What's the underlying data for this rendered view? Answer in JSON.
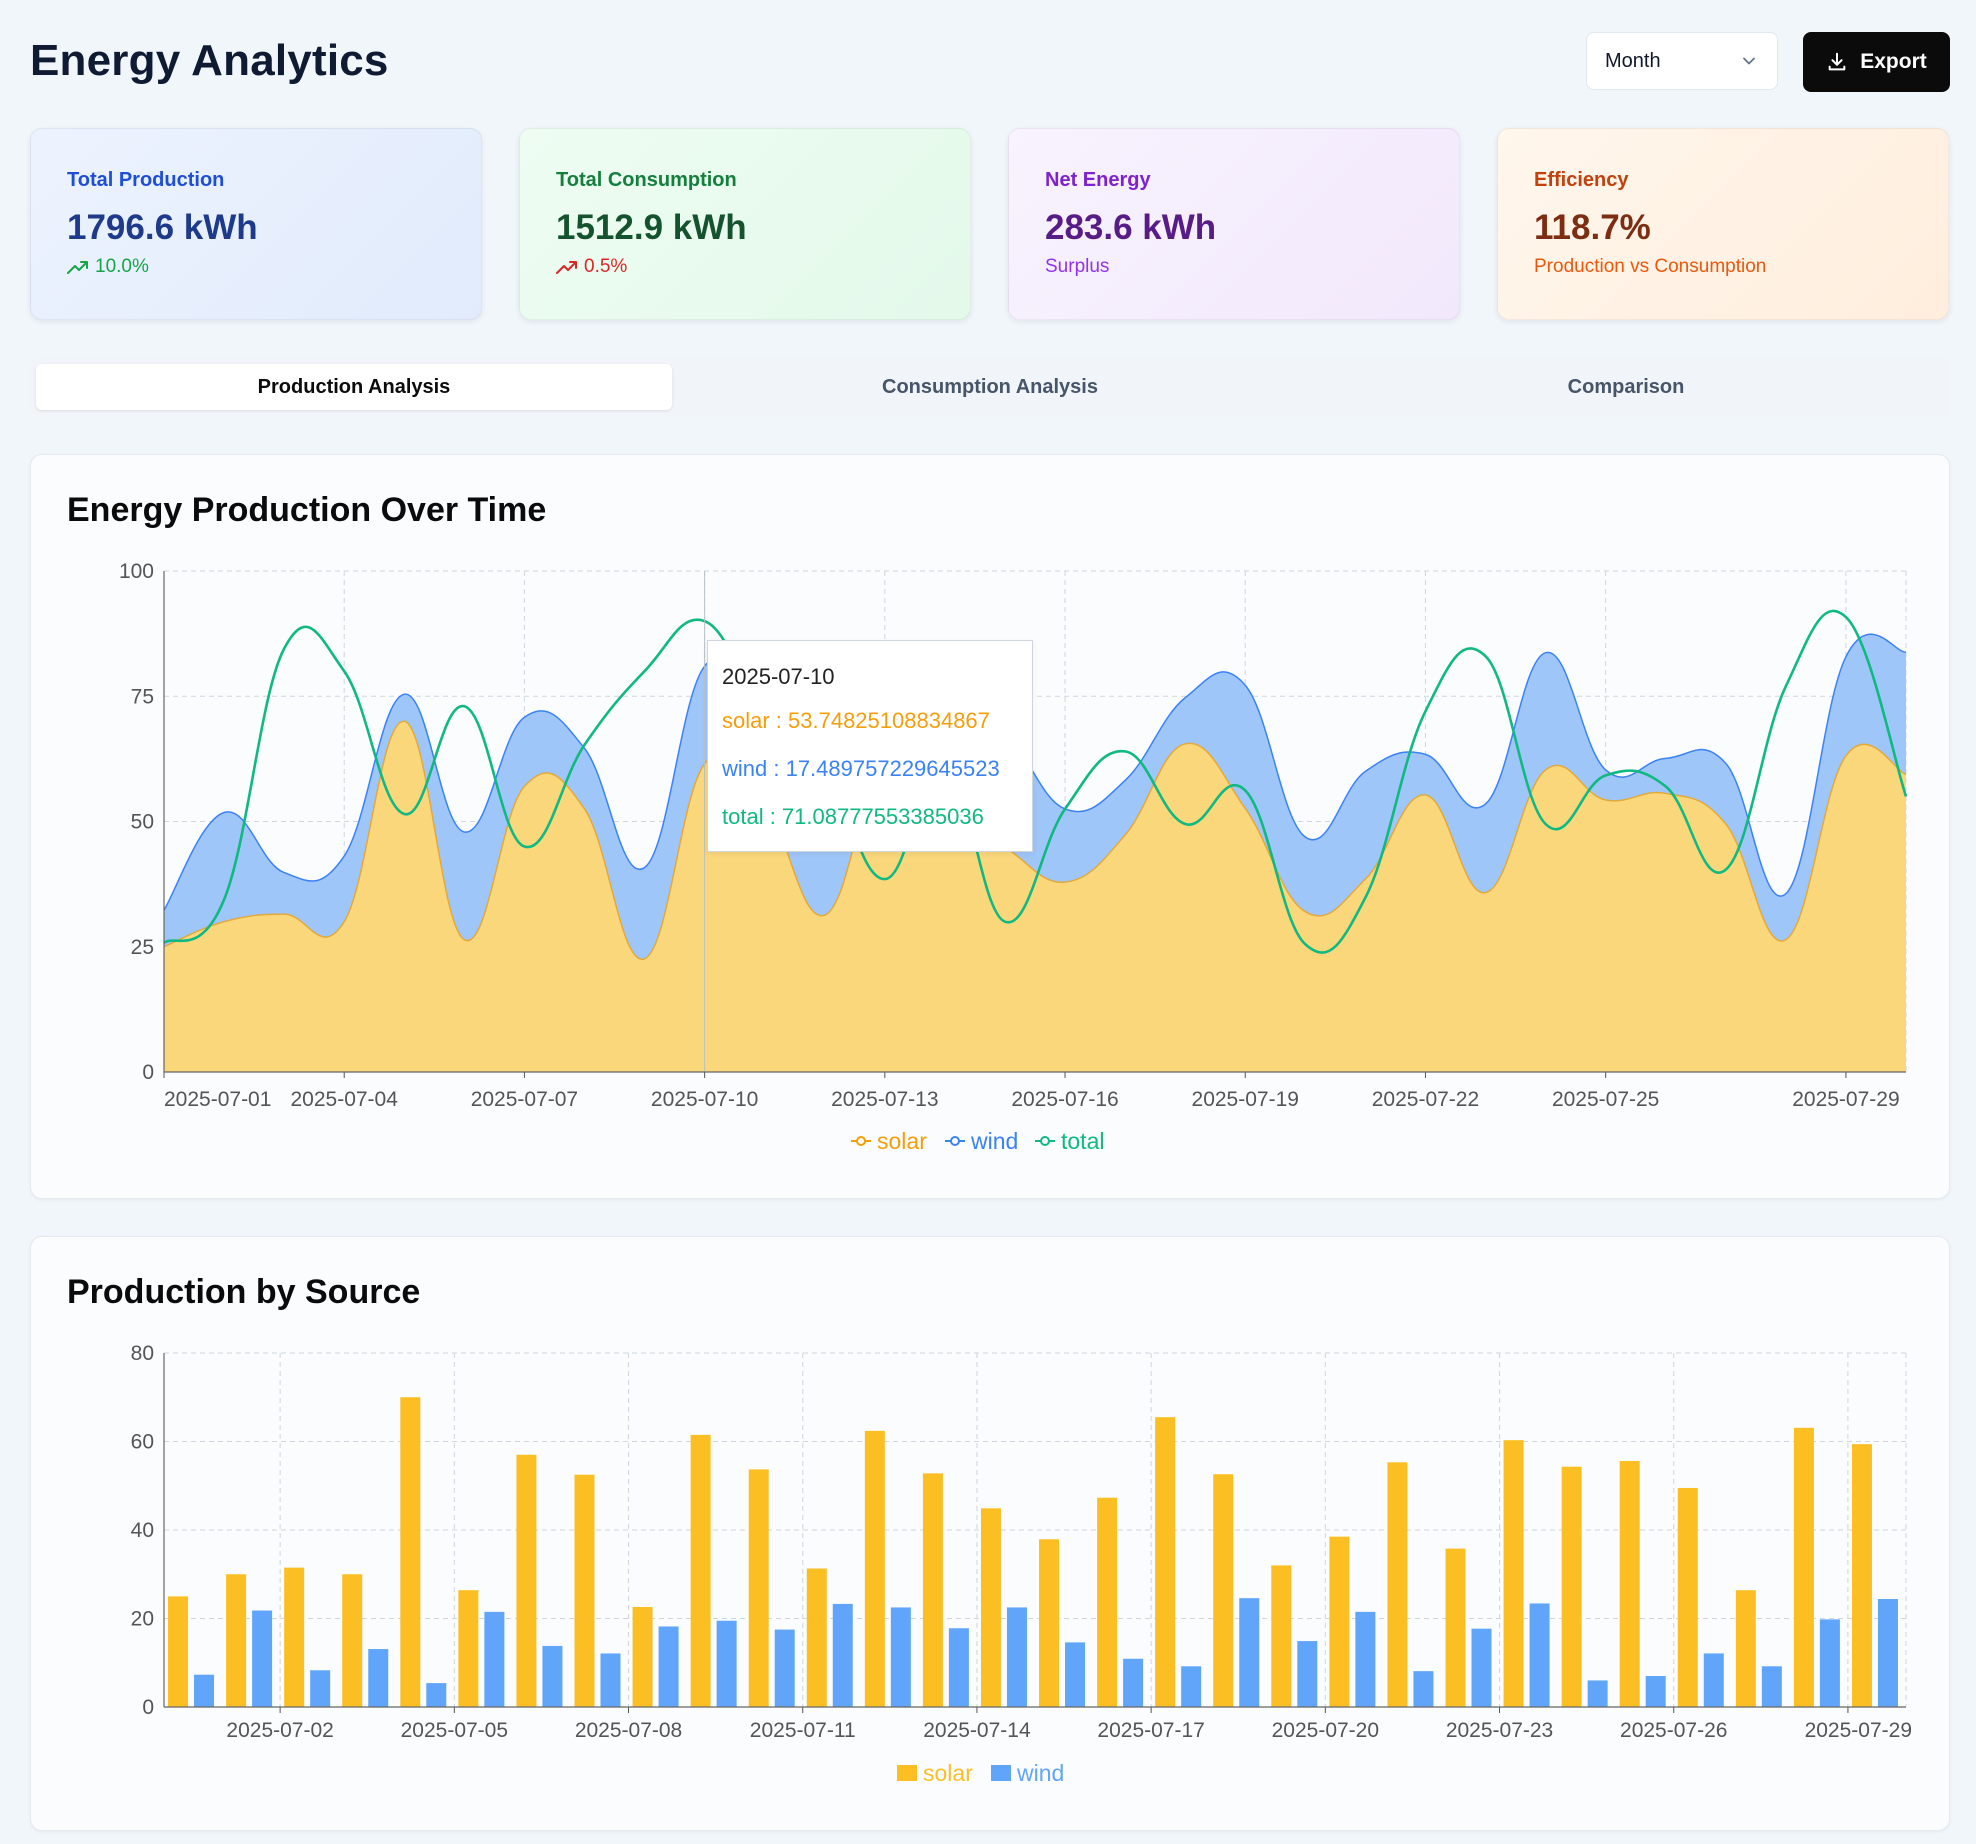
{
  "header": {
    "title": "Energy Analytics",
    "period_select": {
      "value": "Month"
    },
    "export_label": "Export"
  },
  "kpis": [
    {
      "label": "Total Production",
      "value": "1796.6 kWh",
      "sub": "10.0%",
      "trend": "up"
    },
    {
      "label": "Total Consumption",
      "value": "1512.9 kWh",
      "sub": "0.5%",
      "trend": "up"
    },
    {
      "label": "Net Energy",
      "value": "283.6 kWh",
      "sub": "Surplus"
    },
    {
      "label": "Efficiency",
      "value": "118.7%",
      "sub": "Production vs Consumption"
    }
  ],
  "tabs": [
    {
      "label": "Production Analysis",
      "active": true
    },
    {
      "label": "Consumption Analysis",
      "active": false
    },
    {
      "label": "Comparison",
      "active": false
    }
  ],
  "colors": {
    "solar": "#f59e0b",
    "solar_fill": "#fbd77c",
    "solar_bar": "#fbbf24",
    "wind": "#3b82f6",
    "wind_fill": "#9fc6f8",
    "wind_bar": "#60a5fa",
    "total": "#10b981"
  },
  "tooltip": {
    "date": "2025-07-10",
    "solar": "solar : 53.74825108834867",
    "wind": "wind : 17.489757229645523",
    "total": "total : 71.08777553385036"
  },
  "chart_data": [
    {
      "type": "area",
      "title": "Energy Production Over Time",
      "ylim": [
        0,
        100
      ],
      "yticks": [
        0,
        25,
        50,
        75,
        100
      ],
      "x": [
        "2025-07-01",
        "2025-07-02",
        "2025-07-03",
        "2025-07-04",
        "2025-07-05",
        "2025-07-06",
        "2025-07-07",
        "2025-07-08",
        "2025-07-09",
        "2025-07-10",
        "2025-07-11",
        "2025-07-12",
        "2025-07-13",
        "2025-07-14",
        "2025-07-15",
        "2025-07-16",
        "2025-07-17",
        "2025-07-18",
        "2025-07-19",
        "2025-07-20",
        "2025-07-21",
        "2025-07-22",
        "2025-07-23",
        "2025-07-24",
        "2025-07-25",
        "2025-07-26",
        "2025-07-27",
        "2025-07-28",
        "2025-07-29",
        "2025-07-30"
      ],
      "xtick_labels": [
        "2025-07-01",
        "2025-07-04",
        "2025-07-07",
        "2025-07-10",
        "2025-07-13",
        "2025-07-16",
        "2025-07-19",
        "2025-07-22",
        "2025-07-25",
        "2025-07-29"
      ],
      "stacked": true,
      "series": [
        {
          "name": "solar",
          "values": [
            25,
            30,
            31.5,
            30,
            70,
            26.4,
            57,
            52.5,
            22.6,
            61.5,
            53.7,
            31.3,
            62.4,
            52.8,
            44.9,
            37.9,
            47.3,
            65.5,
            52.6,
            32,
            38.5,
            55.3,
            35.8,
            60.3,
            54.3,
            55.6,
            49.5,
            26.4,
            63.1,
            59.4
          ]
        },
        {
          "name": "wind",
          "values": [
            7.3,
            21.8,
            8.3,
            13.1,
            5.4,
            21.5,
            13.8,
            12.1,
            18.2,
            19.5,
            17.5,
            23.3,
            22.5,
            17.8,
            22.5,
            14.6,
            10.9,
            9.2,
            24.6,
            14.9,
            21.5,
            8.1,
            17.7,
            23.4,
            6,
            7,
            12.1,
            9.2,
            19.8,
            24.4
          ]
        },
        {
          "name": "total",
          "values": [
            25.8,
            34.4,
            84.5,
            80,
            51.5,
            73,
            45,
            65.3,
            80,
            90,
            71.1,
            61,
            38.5,
            61.5,
            30,
            52.5,
            64,
            49.5,
            56.2,
            25.5,
            34.8,
            72,
            83,
            49.5,
            59.2,
            57,
            40.4,
            77,
            90.8,
            55
          ]
        }
      ]
    },
    {
      "type": "bar",
      "title": "Production by Source",
      "ylim": [
        0,
        80
      ],
      "yticks": [
        0,
        20,
        40,
        60,
        80
      ],
      "categories": [
        "2025-07-01",
        "2025-07-02",
        "2025-07-03",
        "2025-07-04",
        "2025-07-05",
        "2025-07-06",
        "2025-07-07",
        "2025-07-08",
        "2025-07-09",
        "2025-07-10",
        "2025-07-11",
        "2025-07-12",
        "2025-07-13",
        "2025-07-14",
        "2025-07-15",
        "2025-07-16",
        "2025-07-17",
        "2025-07-18",
        "2025-07-19",
        "2025-07-20",
        "2025-07-21",
        "2025-07-22",
        "2025-07-23",
        "2025-07-24",
        "2025-07-25",
        "2025-07-26",
        "2025-07-27",
        "2025-07-28",
        "2025-07-29",
        "2025-07-30"
      ],
      "xtick_labels": [
        "2025-07-02",
        "2025-07-05",
        "2025-07-08",
        "2025-07-11",
        "2025-07-14",
        "2025-07-17",
        "2025-07-20",
        "2025-07-23",
        "2025-07-26",
        "2025-07-29"
      ],
      "series": [
        {
          "name": "solar",
          "values": [
            25,
            30,
            31.5,
            30,
            70,
            26.4,
            57,
            52.5,
            22.6,
            61.5,
            53.7,
            31.3,
            62.4,
            52.8,
            44.9,
            37.9,
            47.3,
            65.5,
            52.6,
            32,
            38.5,
            55.3,
            35.8,
            60.3,
            54.3,
            55.6,
            49.5,
            26.4,
            63.1,
            59.4
          ]
        },
        {
          "name": "wind",
          "values": [
            7.3,
            21.8,
            8.3,
            13.1,
            5.4,
            21.5,
            13.8,
            12.1,
            18.2,
            19.5,
            17.5,
            23.3,
            22.5,
            17.8,
            22.5,
            14.6,
            10.9,
            9.2,
            24.6,
            14.9,
            21.5,
            8.1,
            17.7,
            23.4,
            6,
            7,
            12.1,
            9.2,
            19.8,
            24.4
          ]
        }
      ]
    }
  ]
}
